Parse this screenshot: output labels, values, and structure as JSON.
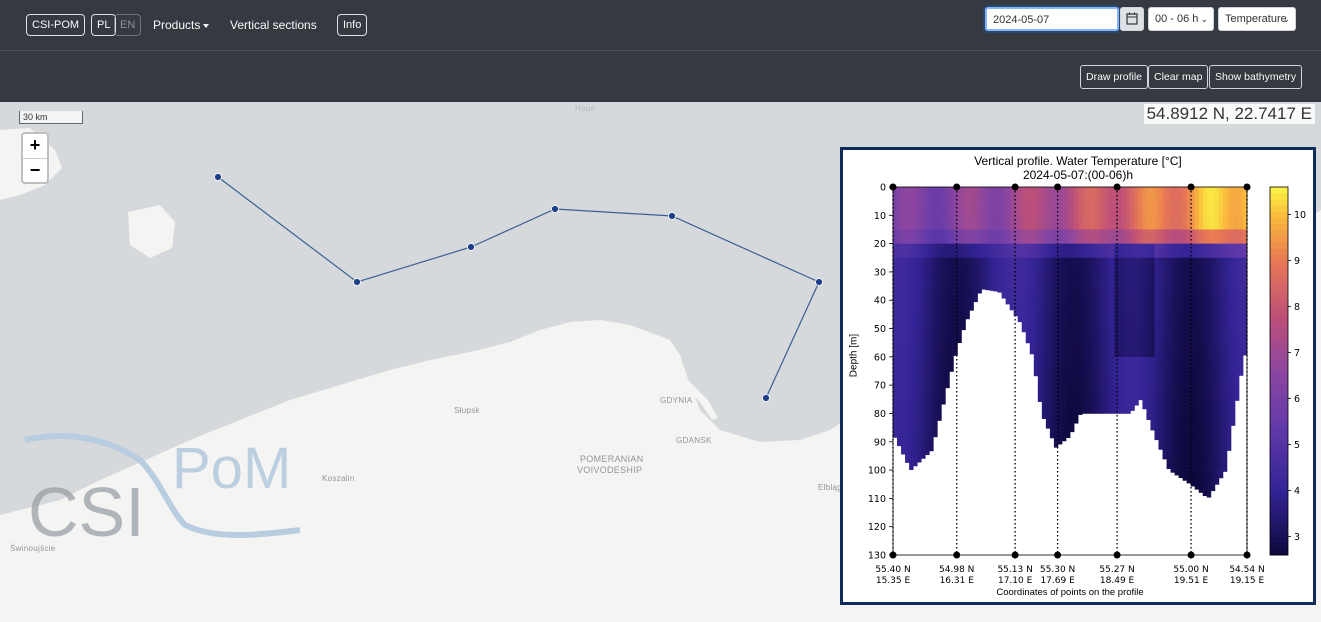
{
  "navbar": {
    "brand": "CSI-POM",
    "lang_pl": "PL",
    "lang_en": "EN",
    "products": "Products",
    "vertical_sections": "Vertical sections",
    "info": "Info",
    "date_value": "2024-05-07",
    "time_selected": "00 - 06 h",
    "parameter_selected": "Temperature"
  },
  "toolbar": {
    "draw_profile": "Draw profile",
    "clear_map": "Clear map",
    "show_bathymetry": "Show bathymetry"
  },
  "map": {
    "scale_label": "30 km",
    "zoom_in": "+",
    "zoom_out": "−",
    "coordinates": "54.8912 N, 22.7417 E",
    "place_labels": [
      "Hope",
      "Słupsk",
      "GDYNIA",
      "GDANSK",
      "POMERANIAN",
      "VOIVODESHIP",
      "Koszalin",
      "Elbląg",
      "Świnoujście"
    ],
    "logo_text": "CSI POM",
    "line_color": "#3b5f93",
    "point_color": "#1c3f8a",
    "profile_points_count_note": ""
  },
  "chart_data": {
    "type": "heatmap",
    "title": "Vertical profile. Water Temperature [°C]",
    "subtitle": "2024-05-07:(00-06)h",
    "xlabel": "Coordinates of points on the profile",
    "ylabel": "Depth [m]",
    "y_ticks": [
      0,
      10,
      20,
      30,
      40,
      50,
      60,
      70,
      80,
      90,
      100,
      110,
      120,
      130
    ],
    "ylim": [
      0,
      130
    ],
    "x_ticks": [
      {
        "lat": "55.40 N",
        "lon": "15.35 E"
      },
      {
        "lat": "54.98 N",
        "lon": "16.31 E"
      },
      {
        "lat": "55.13 N",
        "lon": "17.10 E"
      },
      {
        "lat": "55.30 N",
        "lon": "17.69 E"
      },
      {
        "lat": "55.27 N",
        "lon": "18.49 E"
      },
      {
        "lat": "55.00 N",
        "lon": "19.51 E"
      },
      {
        "lat": "54.54 N",
        "lon": "19.15 E"
      }
    ],
    "colorbar": {
      "ticks": [
        3,
        4,
        5,
        6,
        7,
        8,
        9,
        10
      ],
      "range": [
        2.6,
        10.6
      ],
      "colormap": "plasma-like"
    },
    "surface_temp_range": [
      6,
      10.5
    ],
    "deep_temp_range": [
      3,
      4.5
    ]
  }
}
